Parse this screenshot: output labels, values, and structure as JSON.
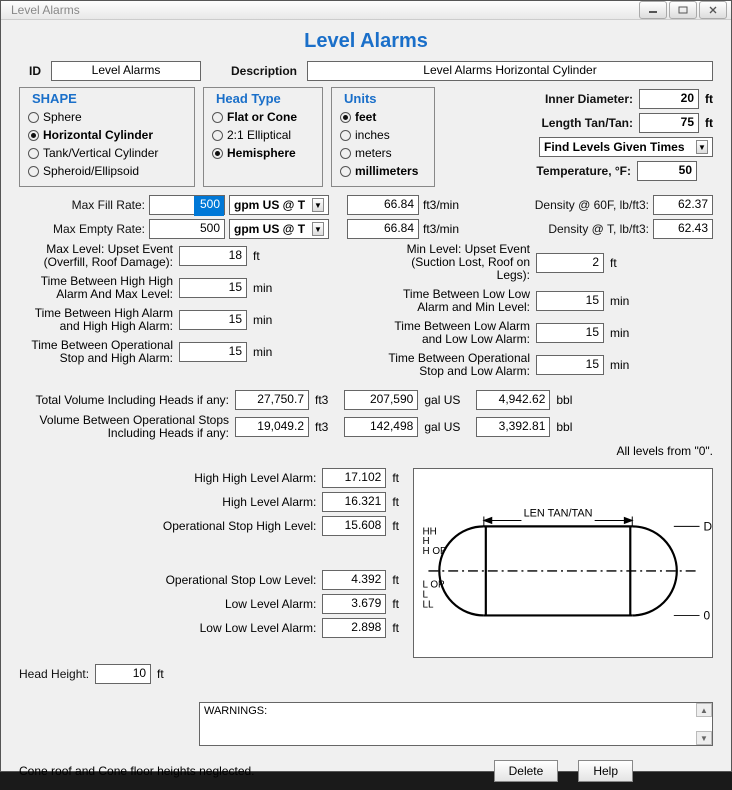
{
  "window": {
    "title": "Level Alarms"
  },
  "header": {
    "title": "Level Alarms",
    "id_label": "ID",
    "id_value": "Level Alarms",
    "desc_label": "Description",
    "desc_value": "Level Alarms Horizontal Cylinder"
  },
  "shape": {
    "legend": "SHAPE",
    "options": [
      "Sphere",
      "Horizontal Cylinder",
      "Tank/Vertical Cylinder",
      "Spheroid/Ellipsoid"
    ],
    "selected": 1
  },
  "head_type": {
    "legend": "Head Type",
    "options": [
      "Flat or Cone",
      "2:1 Elliptical",
      "Hemisphere"
    ],
    "selected": 2
  },
  "units": {
    "legend": "Units",
    "options": [
      "feet",
      "inches",
      "meters",
      "millimeters"
    ],
    "selected": 0
  },
  "params": {
    "inner_diameter": {
      "label": "Inner Diameter:",
      "value": "20",
      "unit": "ft"
    },
    "length": {
      "label": "Length Tan/Tan:",
      "value": "75",
      "unit": "ft"
    },
    "mode": "Find Levels Given Times",
    "temperature": {
      "label": "Temperature, °F:",
      "value": "50"
    }
  },
  "rates": {
    "fill": {
      "label": "Max Fill Rate:",
      "value": "500",
      "unit_sel": "gpm US @ T",
      "ft3": "66.84",
      "ft3_unit": "ft3/min"
    },
    "empty": {
      "label": "Max Empty Rate:",
      "value": "500",
      "unit_sel": "gpm US @ T",
      "ft3": "66.84",
      "ft3_unit": "ft3/min"
    },
    "density60": {
      "label": "Density @ 60F, lb/ft3:",
      "value": "62.37"
    },
    "densityT": {
      "label": "Density @ T, lb/ft3:",
      "value": "62.43"
    }
  },
  "high": {
    "max": {
      "label": "Max Level: Upset Event (Overfill, Roof Damage):",
      "value": "18",
      "unit": "ft"
    },
    "hhmax": {
      "label": "Time Between High High Alarm And Max Level:",
      "value": "15",
      "unit": "min"
    },
    "hhh": {
      "label": "Time Between High Alarm and High High Alarm:",
      "value": "15",
      "unit": "min"
    },
    "oph": {
      "label": "Time Between Operational Stop and High Alarm:",
      "value": "15",
      "unit": "min"
    }
  },
  "low": {
    "min": {
      "label": "Min Level: Upset Event (Suction Lost, Roof on Legs):",
      "value": "2",
      "unit": "ft"
    },
    "llmin": {
      "label": "Time Between Low Low Alarm and Min Level:",
      "value": "15",
      "unit": "min"
    },
    "lll": {
      "label": "Time Between Low Alarm and Low Low Alarm:",
      "value": "15",
      "unit": "min"
    },
    "opl": {
      "label": "Time Between Operational Stop and Low Alarm:",
      "value": "15",
      "unit": "min"
    }
  },
  "totals": {
    "u_ft3": "ft3",
    "u_gal": "gal US",
    "u_bbl": "bbl",
    "total": {
      "label": "Total Volume Including Heads if any:",
      "ft3": "27,750.7",
      "gal": "207,590",
      "bbl": "4,942.62"
    },
    "op": {
      "label": "Volume Between Operational Stops Including Heads if any:",
      "ft3": "19,049.2",
      "gal": "142,498",
      "bbl": "3,392.81"
    }
  },
  "levels": {
    "unit": "ft",
    "hh": {
      "label": "High High Level Alarm:",
      "value": "17.102"
    },
    "h": {
      "label": "High Level Alarm:",
      "value": "16.321"
    },
    "oph": {
      "label": "Operational Stop High Level:",
      "value": "15.608"
    },
    "opl": {
      "label": "Operational Stop Low Level:",
      "value": "4.392"
    },
    "l": {
      "label": "Low Level Alarm:",
      "value": "3.679"
    },
    "ll": {
      "label": "Low Low Level Alarm:",
      "value": "2.898"
    }
  },
  "diagram": {
    "note": "All levels from \"0\".",
    "len_label": "LEN TAN/TAN",
    "D": "D",
    "zero": "0",
    "tags": [
      "HH",
      "H",
      "H OP",
      "L OP",
      "L",
      "LL"
    ]
  },
  "head_height": {
    "label": "Head Height:",
    "value": "10",
    "unit": "ft"
  },
  "warnings": {
    "label": "WARNINGS:"
  },
  "footer": {
    "note": "Cone roof and Cone floor heights neglected.",
    "delete": "Delete",
    "help": "Help"
  }
}
